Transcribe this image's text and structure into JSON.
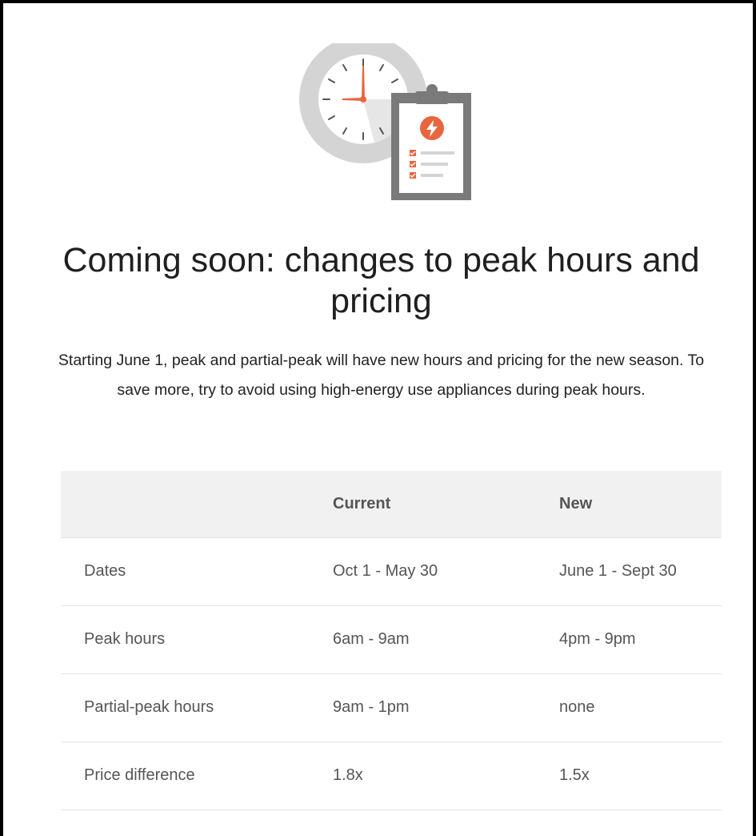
{
  "header": {
    "title": "Coming soon: changes to peak hours and pricing",
    "intro": "Starting June 1, peak and partial-peak will have new hours and pricing for the new season. To save more, try to avoid using high-energy use appliances during peak hours."
  },
  "illustration": {
    "icons": [
      "clock-icon",
      "clipboard-icon",
      "lightning-bolt-icon",
      "checkbox-icon"
    ],
    "colors": {
      "accent": "#e8663d",
      "gray": "#7a7a7a",
      "light_gray": "#d4d4d4"
    }
  },
  "table": {
    "headers": [
      "",
      "Current",
      "New"
    ],
    "rows": [
      {
        "label": "Dates",
        "current": "Oct 1 - May 30",
        "new": "June 1 - Sept 30"
      },
      {
        "label": "Peak hours",
        "current": "6am - 9am",
        "new": "4pm - 9pm"
      },
      {
        "label": "Partial-peak hours",
        "current": "9am - 1pm",
        "new": "none"
      },
      {
        "label": "Price difference",
        "current": "1.8x",
        "new": "1.5x"
      }
    ]
  }
}
